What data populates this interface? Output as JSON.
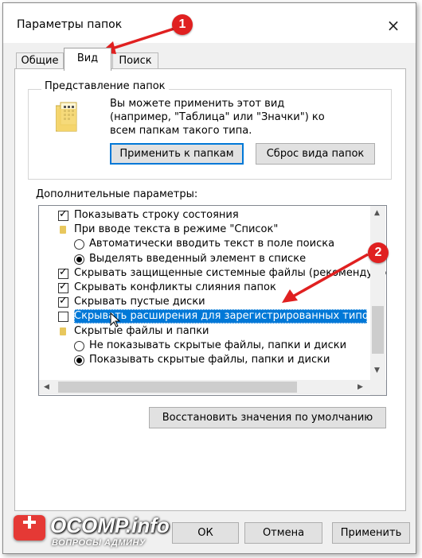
{
  "window": {
    "title": "Параметры папок",
    "close_icon": "×"
  },
  "tabs": [
    {
      "label": "Общие"
    },
    {
      "label": "Вид"
    },
    {
      "label": "Поиск"
    }
  ],
  "folder_views": {
    "title": "Представление папок",
    "description": "Вы можете применить этот вид (например, \"Таблица\" или \"Значки\") ко всем папкам такого типа.",
    "apply_label": "Применить к папкам",
    "reset_label": "Сброс вида папок"
  },
  "advanced": {
    "label": "Дополнительные параметры:",
    "items": [
      {
        "type": "checkbox",
        "checked": true,
        "label": "Показывать строку состояния"
      },
      {
        "type": "folder",
        "label": "При вводе текста в режиме \"Список\""
      },
      {
        "type": "radio",
        "checked": false,
        "label": "Автоматически вводить текст в поле поиска"
      },
      {
        "type": "radio",
        "checked": true,
        "label": "Выделять введенный элемент в списке"
      },
      {
        "type": "checkbox",
        "checked": true,
        "label": "Скрывать защищенные системные файлы (рекомендуетс"
      },
      {
        "type": "checkbox",
        "checked": true,
        "label": "Скрывать конфликты слияния папок"
      },
      {
        "type": "checkbox",
        "checked": true,
        "label": "Скрывать пустые диски"
      },
      {
        "type": "checkbox",
        "checked": false,
        "selected": true,
        "label": "Скрывать расширения для зарегистрированных типов ф"
      },
      {
        "type": "folder",
        "label": "Скрытые файлы и папки"
      },
      {
        "type": "radio",
        "checked": false,
        "label": "Не показывать скрытые файлы, папки и диски"
      },
      {
        "type": "radio",
        "checked": true,
        "label": "Показывать скрытые файлы, папки и диски"
      }
    ]
  },
  "restore_defaults_label": "Восстановить значения по умолчанию",
  "footer": {
    "ok_label": "ОК",
    "cancel_label": "Отмена",
    "apply_label": "Применить"
  },
  "annotations": {
    "badge1": "1",
    "badge2": "2"
  },
  "watermark": {
    "brand": "OCOMP.info",
    "tagline": "ВОПРОСЫ АДМИНУ"
  },
  "colors": {
    "selection": "#0078d7",
    "badge": "#e02020",
    "accent_border": "#0078d7"
  }
}
